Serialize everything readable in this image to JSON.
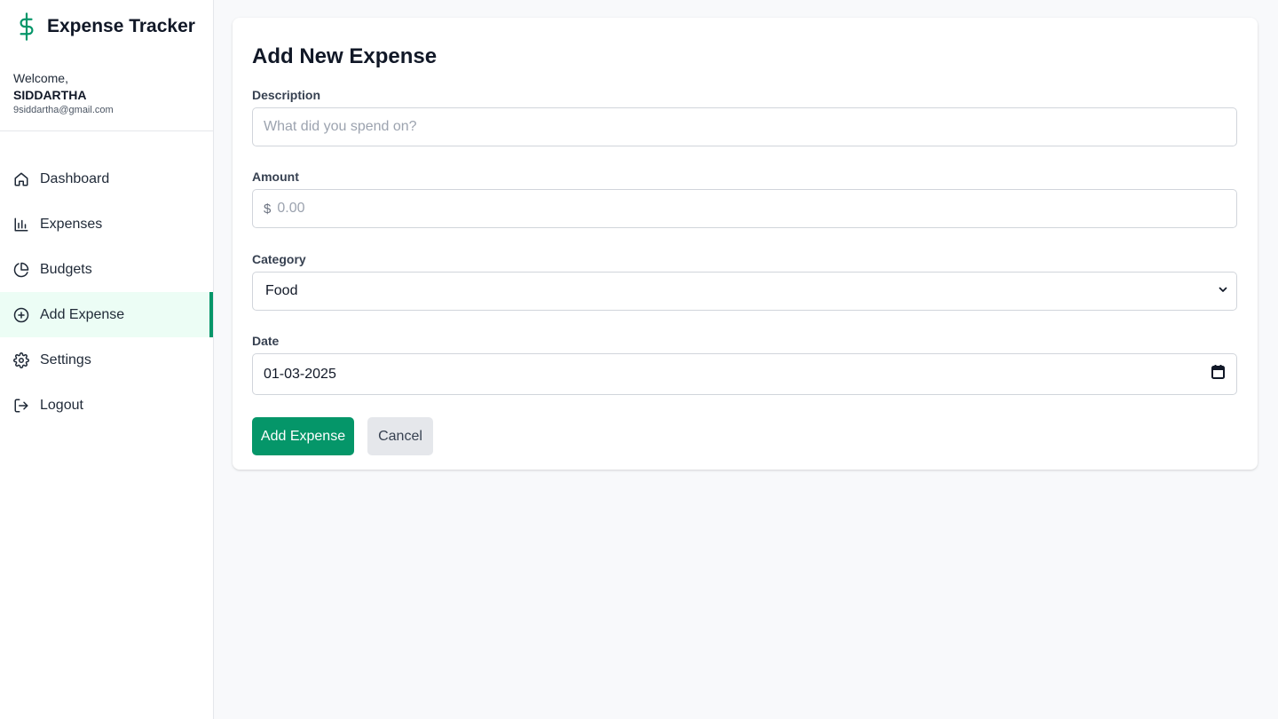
{
  "app": {
    "title": "Expense Tracker",
    "logo_icon": "dollar-sign-icon",
    "accent": "#059669"
  },
  "user": {
    "welcome": "Welcome,",
    "name": "SIDDARTHA",
    "email": "9siddartha@gmail.com"
  },
  "sidebar": {
    "items": [
      {
        "label": "Dashboard",
        "icon": "home-icon",
        "active": false
      },
      {
        "label": "Expenses",
        "icon": "bar-chart-icon",
        "active": false
      },
      {
        "label": "Budgets",
        "icon": "pie-chart-icon",
        "active": false
      },
      {
        "label": "Add Expense",
        "icon": "plus-circle-icon",
        "active": true
      },
      {
        "label": "Settings",
        "icon": "gear-icon",
        "active": false
      },
      {
        "label": "Logout",
        "icon": "logout-icon",
        "active": false
      }
    ]
  },
  "form": {
    "title": "Add New Expense",
    "description": {
      "label": "Description",
      "placeholder": "What did you spend on?",
      "value": ""
    },
    "amount": {
      "label": "Amount",
      "prefix": "$",
      "placeholder": "0.00",
      "value": ""
    },
    "category": {
      "label": "Category",
      "selected": "Food"
    },
    "date": {
      "label": "Date",
      "value": "01-03-2025"
    },
    "submit_label": "Add Expense",
    "cancel_label": "Cancel"
  }
}
